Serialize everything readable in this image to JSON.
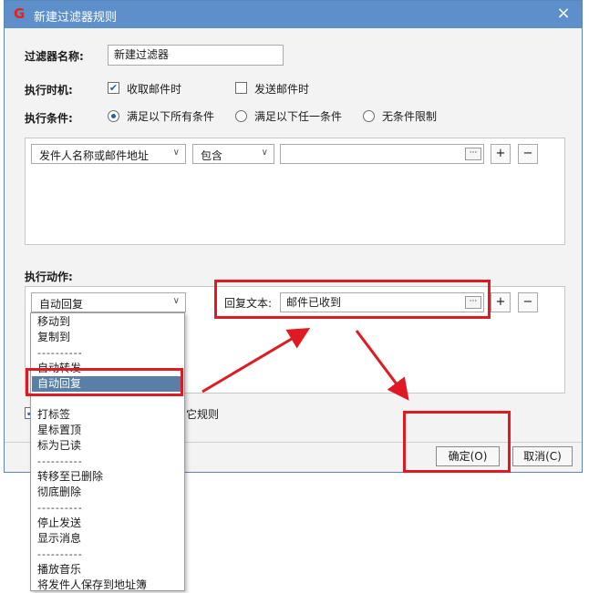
{
  "window": {
    "title": "新建过滤器规则",
    "close_icon": "×"
  },
  "form": {
    "name_label": "过滤器名称:",
    "name_value": "新建过滤器",
    "timing_label": "执行时机:",
    "timing_receive": "收取邮件时",
    "timing_receive_checked": true,
    "timing_send": "发送邮件时",
    "timing_send_checked": false,
    "condition_label": "执行条件:",
    "condition_all": "满足以下所有条件",
    "condition_any": "满足以下任一条件",
    "condition_none": "无条件限制",
    "condition_selected": "all"
  },
  "condition_row": {
    "field": "发件人名称或邮件地址",
    "operator": "包含",
    "value": "",
    "dots": "···",
    "add": "+",
    "remove": "−"
  },
  "action": {
    "label": "执行动作:",
    "selected": "自动回复",
    "reply_label": "回复文本:",
    "reply_value": "邮件已收到",
    "dots": "···",
    "add": "+",
    "remove": "−"
  },
  "dropdown": {
    "items": [
      {
        "text": "移动到",
        "type": "item"
      },
      {
        "text": "复制到",
        "type": "item"
      },
      {
        "text": "----------",
        "type": "sep"
      },
      {
        "text": "自动转发",
        "type": "item"
      },
      {
        "text": "自动回复",
        "type": "item",
        "selected": true
      },
      {
        "text": "",
        "type": "blank"
      },
      {
        "text": "打标签",
        "type": "item"
      },
      {
        "text": "星标置顶",
        "type": "item"
      },
      {
        "text": "标为已读",
        "type": "item"
      },
      {
        "text": "----------",
        "type": "sep"
      },
      {
        "text": "转移至已删除",
        "type": "item"
      },
      {
        "text": "彻底删除",
        "type": "item"
      },
      {
        "text": "----------",
        "type": "sep"
      },
      {
        "text": "停止发送",
        "type": "item"
      },
      {
        "text": "显示消息",
        "type": "item"
      },
      {
        "text": "----------",
        "type": "sep"
      },
      {
        "text": "播放音乐",
        "type": "item"
      },
      {
        "text": "将发件人保存到地址簿",
        "type": "item"
      }
    ]
  },
  "other_rules": {
    "text": "它规则",
    "checked": true
  },
  "footer": {
    "ok": "确定(O)",
    "cancel": "取消(C)"
  },
  "colors": {
    "titlebar": "#5d8fca",
    "annotation": "#e01a22",
    "selected_item": "#5a7fa6"
  }
}
